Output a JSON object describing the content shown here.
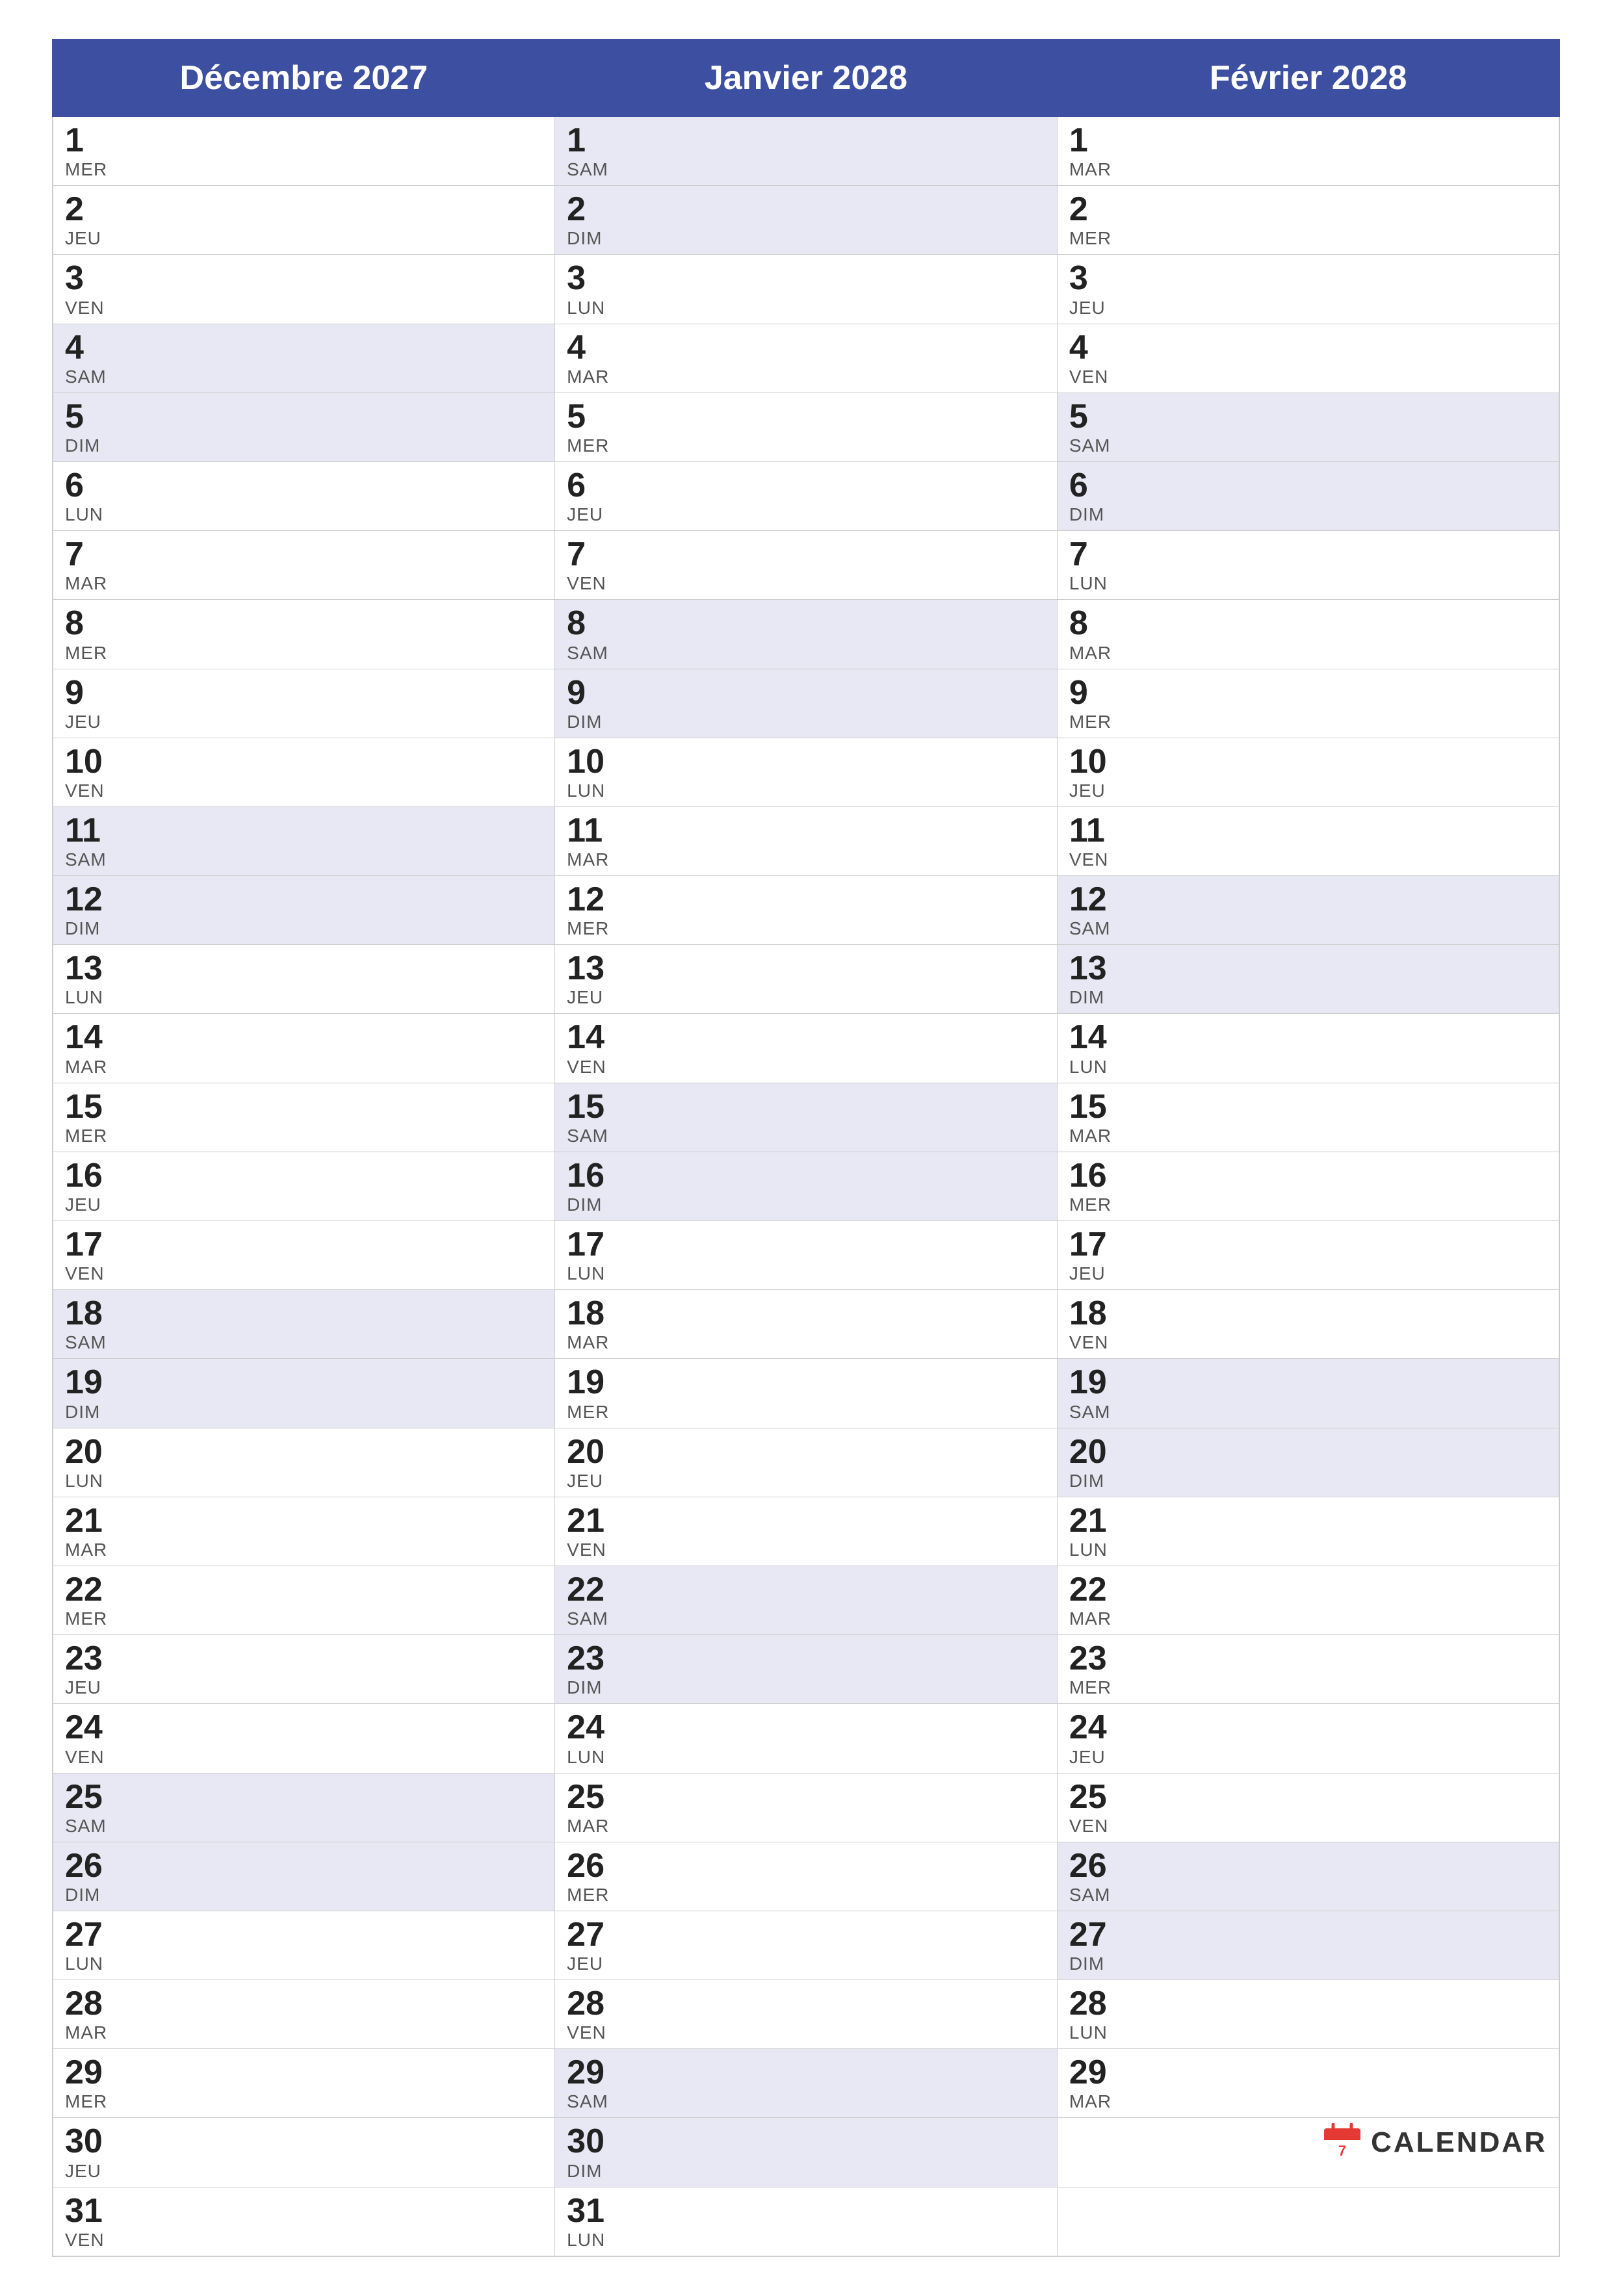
{
  "months": [
    {
      "name": "Décembre 2027",
      "col": "col-dec"
    },
    {
      "name": "Janvier 2028",
      "col": "col-jan"
    },
    {
      "name": "Février 2028",
      "col": "col-feb"
    }
  ],
  "rows": [
    {
      "dec": {
        "num": "1",
        "day": "MER"
      },
      "jan": {
        "num": "1",
        "day": "SAM"
      },
      "feb": {
        "num": "1",
        "day": "MAR"
      },
      "weekend": false
    },
    {
      "dec": {
        "num": "2",
        "day": "JEU"
      },
      "jan": {
        "num": "2",
        "day": "DIM"
      },
      "feb": {
        "num": "2",
        "day": "MER"
      },
      "weekend": false
    },
    {
      "dec": {
        "num": "3",
        "day": "VEN"
      },
      "jan": {
        "num": "3",
        "day": "LUN"
      },
      "feb": {
        "num": "3",
        "day": "JEU"
      },
      "weekend": false
    },
    {
      "dec": {
        "num": "4",
        "day": "SAM"
      },
      "jan": {
        "num": "4",
        "day": "MAR"
      },
      "feb": {
        "num": "4",
        "day": "VEN"
      },
      "weekend": true
    },
    {
      "dec": {
        "num": "5",
        "day": "DIM"
      },
      "jan": {
        "num": "5",
        "day": "MER"
      },
      "feb": {
        "num": "5",
        "day": "SAM"
      },
      "weekend": true
    },
    {
      "dec": {
        "num": "6",
        "day": "LUN"
      },
      "jan": {
        "num": "6",
        "day": "JEU"
      },
      "feb": {
        "num": "6",
        "day": "DIM"
      },
      "weekend": false,
      "feb_weekend": true
    },
    {
      "dec": {
        "num": "7",
        "day": "MAR"
      },
      "jan": {
        "num": "7",
        "day": "VEN"
      },
      "feb": {
        "num": "7",
        "day": "LUN"
      },
      "weekend": false
    },
    {
      "dec": {
        "num": "8",
        "day": "MER"
      },
      "jan": {
        "num": "8",
        "day": "SAM"
      },
      "feb": {
        "num": "8",
        "day": "MAR"
      },
      "weekend": false,
      "jan_weekend": true
    },
    {
      "dec": {
        "num": "9",
        "day": "JEU"
      },
      "jan": {
        "num": "9",
        "day": "DIM"
      },
      "feb": {
        "num": "9",
        "day": "MER"
      },
      "weekend": false,
      "jan_weekend": true
    },
    {
      "dec": {
        "num": "10",
        "day": "VEN"
      },
      "jan": {
        "num": "10",
        "day": "LUN"
      },
      "feb": {
        "num": "10",
        "day": "JEU"
      },
      "weekend": false
    },
    {
      "dec": {
        "num": "11",
        "day": "SAM"
      },
      "jan": {
        "num": "11",
        "day": "MAR"
      },
      "feb": {
        "num": "11",
        "day": "VEN"
      },
      "weekend": true
    },
    {
      "dec": {
        "num": "12",
        "day": "DIM"
      },
      "jan": {
        "num": "12",
        "day": "MER"
      },
      "feb": {
        "num": "12",
        "day": "SAM"
      },
      "weekend": true
    },
    {
      "dec": {
        "num": "13",
        "day": "LUN"
      },
      "jan": {
        "num": "13",
        "day": "JEU"
      },
      "feb": {
        "num": "13",
        "day": "DIM"
      },
      "weekend": false,
      "feb_weekend": true
    },
    {
      "dec": {
        "num": "14",
        "day": "MAR"
      },
      "jan": {
        "num": "14",
        "day": "VEN"
      },
      "feb": {
        "num": "14",
        "day": "LUN"
      },
      "weekend": false
    },
    {
      "dec": {
        "num": "15",
        "day": "MER"
      },
      "jan": {
        "num": "15",
        "day": "SAM"
      },
      "feb": {
        "num": "15",
        "day": "MAR"
      },
      "weekend": false,
      "jan_weekend": true
    },
    {
      "dec": {
        "num": "16",
        "day": "JEU"
      },
      "jan": {
        "num": "16",
        "day": "DIM"
      },
      "feb": {
        "num": "16",
        "day": "MER"
      },
      "weekend": false,
      "jan_weekend": true
    },
    {
      "dec": {
        "num": "17",
        "day": "VEN"
      },
      "jan": {
        "num": "17",
        "day": "LUN"
      },
      "feb": {
        "num": "17",
        "day": "JEU"
      },
      "weekend": false
    },
    {
      "dec": {
        "num": "18",
        "day": "SAM"
      },
      "jan": {
        "num": "18",
        "day": "MAR"
      },
      "feb": {
        "num": "18",
        "day": "VEN"
      },
      "weekend": true
    },
    {
      "dec": {
        "num": "19",
        "day": "DIM"
      },
      "jan": {
        "num": "19",
        "day": "MER"
      },
      "feb": {
        "num": "19",
        "day": "SAM"
      },
      "weekend": true
    },
    {
      "dec": {
        "num": "20",
        "day": "LUN"
      },
      "jan": {
        "num": "20",
        "day": "JEU"
      },
      "feb": {
        "num": "20",
        "day": "DIM"
      },
      "weekend": false,
      "feb_weekend": true
    },
    {
      "dec": {
        "num": "21",
        "day": "MAR"
      },
      "jan": {
        "num": "21",
        "day": "VEN"
      },
      "feb": {
        "num": "21",
        "day": "LUN"
      },
      "weekend": false
    },
    {
      "dec": {
        "num": "22",
        "day": "MER"
      },
      "jan": {
        "num": "22",
        "day": "SAM"
      },
      "feb": {
        "num": "22",
        "day": "MAR"
      },
      "weekend": false,
      "jan_weekend": true
    },
    {
      "dec": {
        "num": "23",
        "day": "JEU"
      },
      "jan": {
        "num": "23",
        "day": "DIM"
      },
      "feb": {
        "num": "23",
        "day": "MER"
      },
      "weekend": false,
      "jan_weekend": true
    },
    {
      "dec": {
        "num": "24",
        "day": "VEN"
      },
      "jan": {
        "num": "24",
        "day": "LUN"
      },
      "feb": {
        "num": "24",
        "day": "JEU"
      },
      "weekend": false
    },
    {
      "dec": {
        "num": "25",
        "day": "SAM"
      },
      "jan": {
        "num": "25",
        "day": "MAR"
      },
      "feb": {
        "num": "25",
        "day": "VEN"
      },
      "weekend": true
    },
    {
      "dec": {
        "num": "26",
        "day": "DIM"
      },
      "jan": {
        "num": "26",
        "day": "MER"
      },
      "feb": {
        "num": "26",
        "day": "SAM"
      },
      "weekend": true
    },
    {
      "dec": {
        "num": "27",
        "day": "LUN"
      },
      "jan": {
        "num": "27",
        "day": "JEU"
      },
      "feb": {
        "num": "27",
        "day": "DIM"
      },
      "weekend": false,
      "feb_weekend": true
    },
    {
      "dec": {
        "num": "28",
        "day": "MAR"
      },
      "jan": {
        "num": "28",
        "day": "VEN"
      },
      "feb": {
        "num": "28",
        "day": "LUN"
      },
      "weekend": false
    },
    {
      "dec": {
        "num": "29",
        "day": "MER"
      },
      "jan": {
        "num": "29",
        "day": "SAM"
      },
      "feb": {
        "num": "29",
        "day": "MAR"
      },
      "weekend": false,
      "jan_weekend": true
    },
    {
      "dec": {
        "num": "30",
        "day": "JEU"
      },
      "jan": {
        "num": "30",
        "day": "DIM"
      },
      "feb": null,
      "weekend": false,
      "jan_weekend": true,
      "has_logo": true
    },
    {
      "dec": {
        "num": "31",
        "day": "VEN"
      },
      "jan": {
        "num": "31",
        "day": "LUN"
      },
      "feb": null,
      "weekend": false
    }
  ],
  "logo": {
    "text": "CALENDAR",
    "icon_color": "#e53935"
  }
}
